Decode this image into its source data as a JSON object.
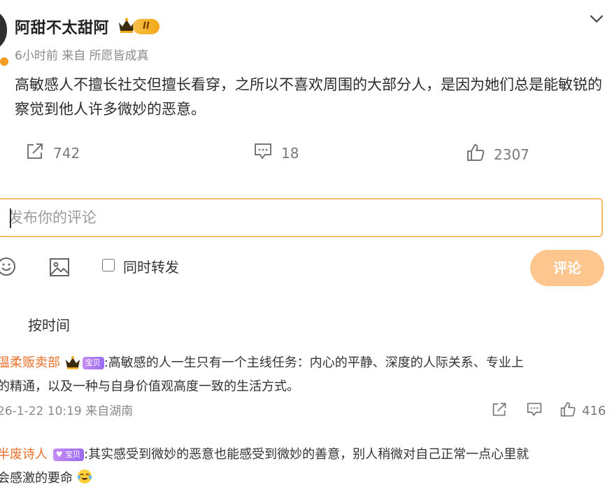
{
  "post": {
    "author": "阿甜不太甜阿",
    "vip_level": "II",
    "meta": "6小时前  来自 所愿皆成真",
    "body": "高敏感人不擅长社交但擅长看穿，之所以不喜欢周围的大部分人，是因为她们总是能敏锐的察觉到他人许多微妙的恶意。",
    "reposts": "742",
    "comments": "18",
    "likes": "2307"
  },
  "composer": {
    "placeholder": "发布你的评论",
    "forward_label": "同时转发",
    "submit_label": "评论"
  },
  "sort_label": "按时间",
  "comment_list": [
    {
      "user": "温柔贩卖部",
      "badge": "宝贝",
      "text_line1": ":高敏感的人一生只有一个主线任务：内心的平静、深度的人际关系、专业上",
      "text_line2": "的精通，以及一种与自身价值观高度一致的生活方式。",
      "meta": "26-1-22 10:19 来自湖南",
      "likes": "416"
    },
    {
      "user": "半废诗人",
      "badge": "宝贝",
      "text_line1": ":其实感受到微妙的恶意也能感受到微妙的善意，别人稍微对自己正常一点心里就",
      "text_line2": "会感激的要命"
    }
  ],
  "colors": {
    "accent_orange": "#f7be6a",
    "button": "#fcc68e",
    "username": "#e8722d",
    "vip_gold": "#f3a814",
    "badge_purple": "#9b6cf0"
  },
  "icons": [
    "chevron-down-icon",
    "repost-icon",
    "comment-icon",
    "like-icon",
    "emoji-icon",
    "image-icon",
    "crown-icon",
    "laugh-cry-emoji"
  ]
}
